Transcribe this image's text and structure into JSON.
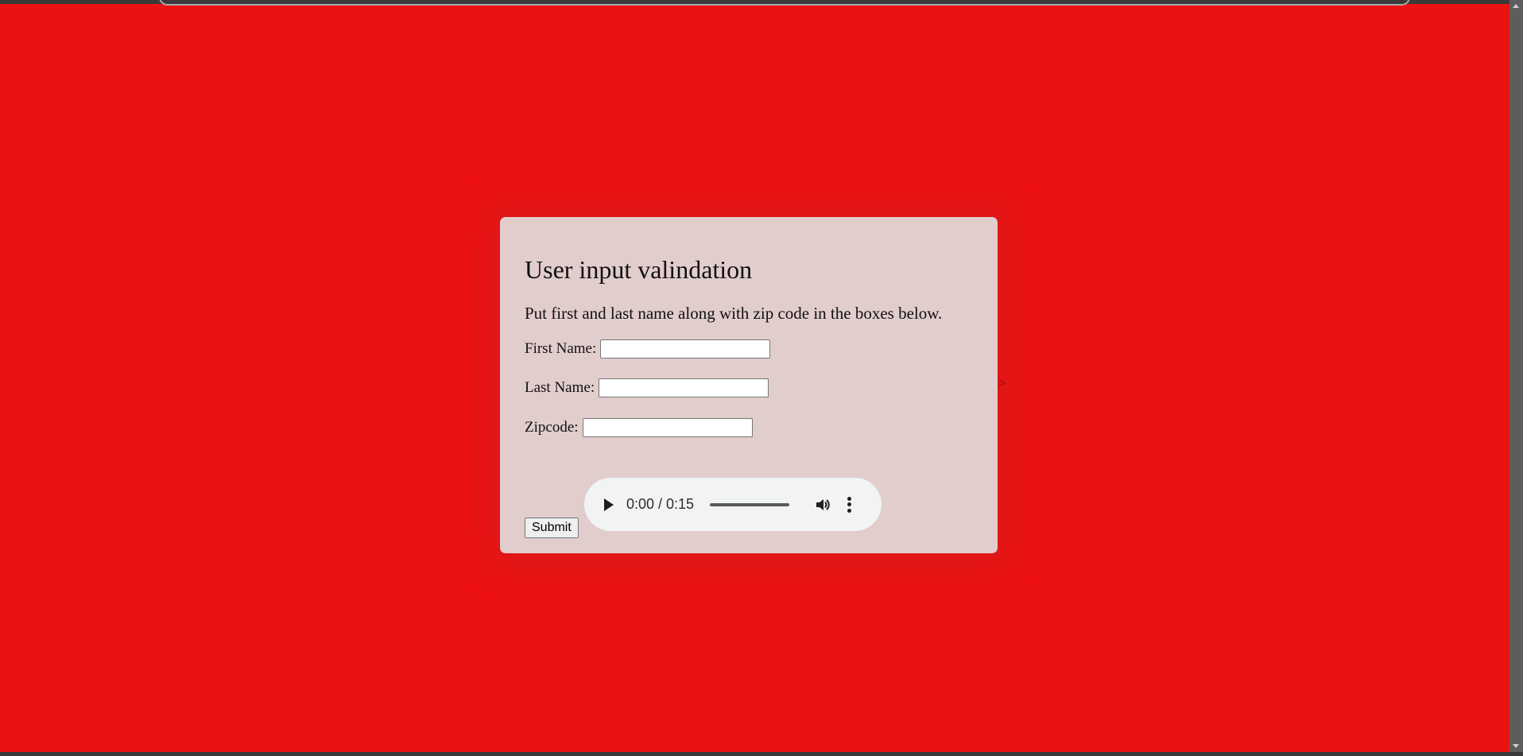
{
  "form": {
    "title": "User input valindation",
    "intro": "Put first and last name along with zip code in the boxes below.",
    "fields": [
      {
        "label": "First Name:",
        "value": ""
      },
      {
        "label": "Last Name:",
        "value": ""
      },
      {
        "label": "Zipcode:",
        "value": ""
      }
    ],
    "submit_label": "Submit"
  },
  "audio": {
    "time": "0:00 / 0:15",
    "progress": 0
  },
  "stray_glyph": ">",
  "colors": {
    "page_background": "#ed1212",
    "card_background": "#e2cdcd",
    "audio_background": "#f1f3f4"
  },
  "icons": [
    "play-icon",
    "volume-icon",
    "more-options-icon",
    "scroll-up-icon",
    "scroll-down-icon"
  ]
}
